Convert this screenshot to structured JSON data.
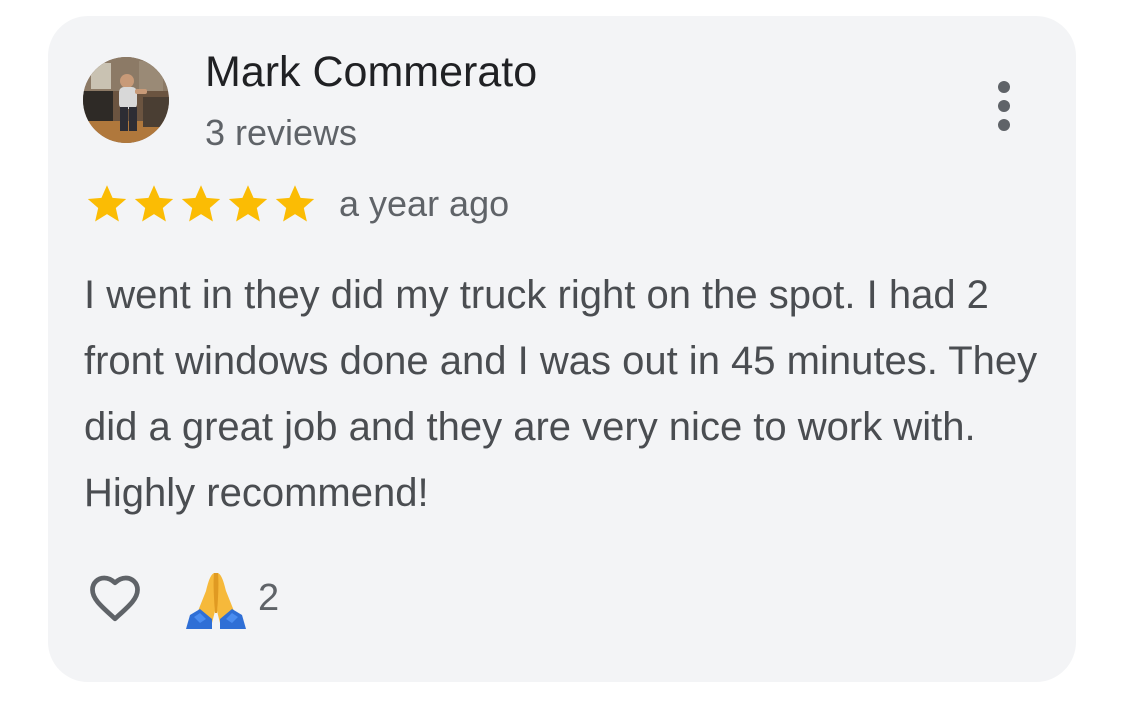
{
  "review": {
    "author": {
      "name": "Mark Commerato",
      "review_count": "3 reviews",
      "avatar_icon": "profile-photo"
    },
    "rating": {
      "stars": 5,
      "max_stars": 5,
      "star_color": "#fbbc04"
    },
    "date": "a year ago",
    "text": "I went in they did my truck right on the spot. I had 2 front windows done and I was out in 45 minutes. They did a great job and they are very nice to work with. Highly recommend!",
    "actions": {
      "like_icon": "heart-outline-icon",
      "reaction_icon": "folded-hands-icon",
      "reaction_count": "2"
    },
    "menu_icon": "more-vertical-icon"
  },
  "colors": {
    "card_background": "#f3f4f6",
    "name_text": "#202124",
    "secondary_text": "#5f6368",
    "body_text": "#4a4d51"
  }
}
